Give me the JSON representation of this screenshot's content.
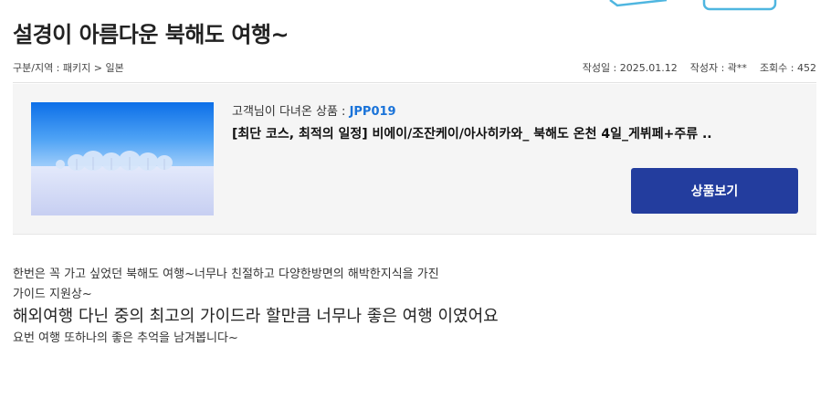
{
  "post": {
    "title": "설경이 아름다운 북해도 여행~",
    "category_path": "구분/지역 : 패키지 > 일본",
    "date": "작성일 : 2025.01.12",
    "author": "작성자 : 곽**",
    "views": "조회수 : 452"
  },
  "product": {
    "label_prefix": "고객님이 다녀온 상품 : ",
    "code": "JPP019",
    "title": "[최단 코스, 최적의 일정] 비에이/조잔케이/아사히카와_ 북해도 온천 4일_게뷔페+주류 ..",
    "button_label": "상품보기",
    "image_alt": "snow-field-trees-photo"
  },
  "review": {
    "lines": [
      "한번은 꼭 가고 싶었던 북해도 여행~너무나 친절하고 다양한방면의 해박한지식을 가진",
      "가이드 지원상~",
      "해외여행 다닌 중의 최고의 가이드라 할만큼 너무나 좋은 여행 이였어요",
      "요번 여행 또하나의 좋은 추억을 남겨봅니다~"
    ]
  },
  "colors": {
    "accent_blue": "#1a73d9",
    "button_bg": "#233d9e",
    "box_bg": "#f5f5f5",
    "decoration": "#4fb6e0"
  }
}
